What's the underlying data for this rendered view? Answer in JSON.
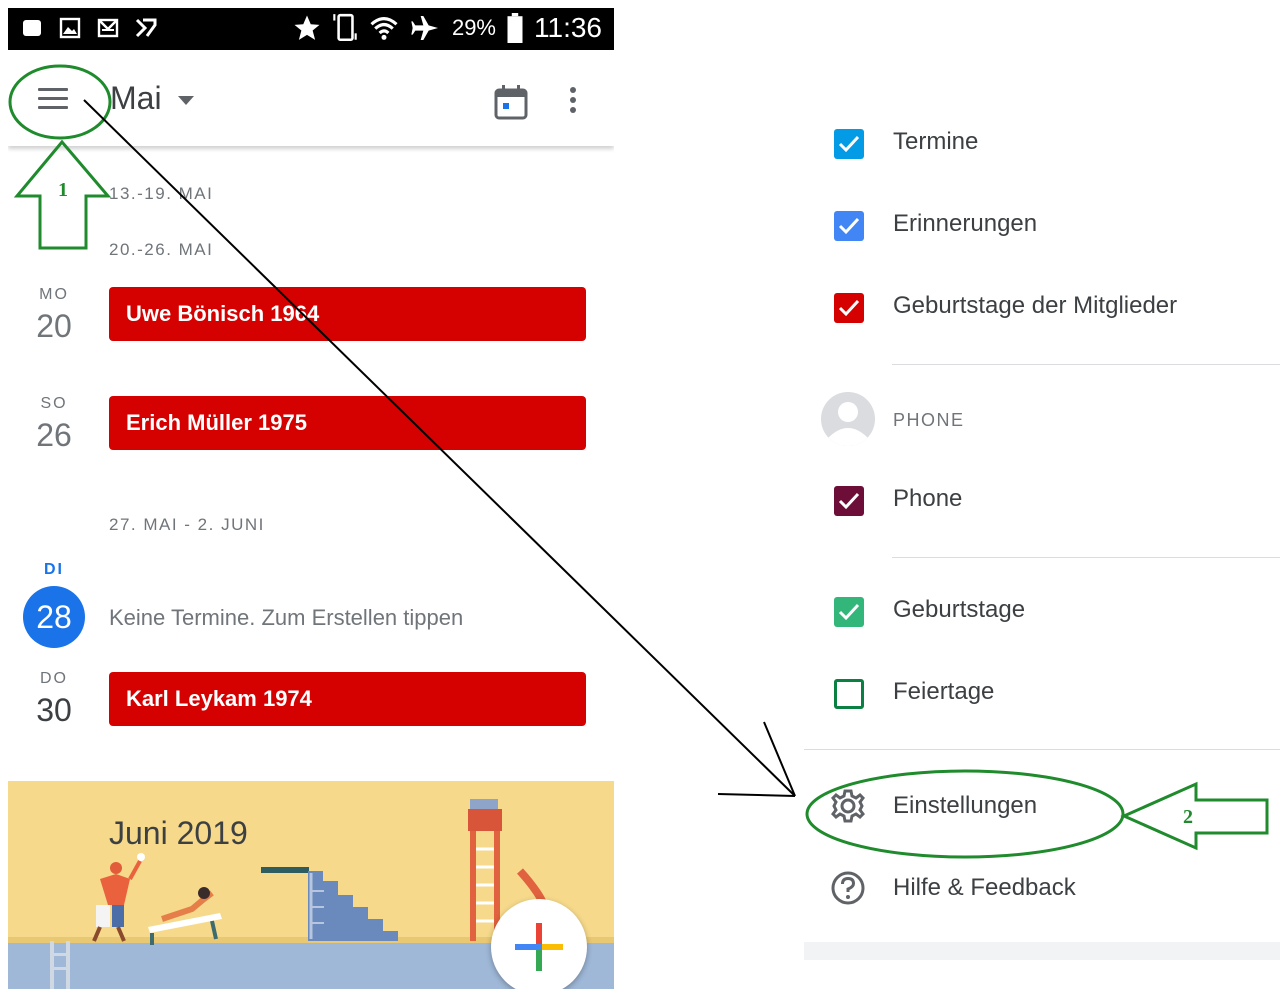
{
  "status_bar": {
    "battery_percent": "29%",
    "time": "11:36",
    "icons": [
      "notification-icon",
      "image-icon",
      "mail-icon",
      "check-icon",
      "star-icon",
      "vibrate-icon",
      "wifi-icon",
      "airplane-icon",
      "battery-icon"
    ]
  },
  "app_bar": {
    "month": "Mai",
    "icons": [
      "menu-icon",
      "caret-down-icon",
      "calendar-today-icon",
      "more-vert-icon"
    ]
  },
  "schedule": {
    "week1_label": "13.-19. MAI",
    "week2_label": "20.-26. MAI",
    "days": [
      {
        "name": "MO",
        "num": "20",
        "event": "Uwe Bönisch 1964"
      },
      {
        "name": "SO",
        "num": "26",
        "event": "Erich Müller 1975"
      }
    ],
    "week3_label": "27. MAI - 2. JUNI",
    "today": {
      "name": "DI",
      "num": "28",
      "empty_text": "Keine Termine. Zum Erstellen tippen"
    },
    "day4": {
      "name": "DO",
      "num": "30",
      "event": "Karl Leykam 1974"
    },
    "event_color": "#d50000",
    "today_color": "#1a73e8"
  },
  "banner": {
    "title": "Juni 2019",
    "bg_color": "#f6d98a"
  },
  "fab": {
    "icon": "plus-icon"
  },
  "drawer": {
    "calendars": [
      {
        "label": "Termine",
        "color": "#039be5",
        "checked": true
      },
      {
        "label": "Erinnerungen",
        "color": "#4285f4",
        "checked": true
      },
      {
        "label": "Geburtstage der Mitglieder",
        "color": "#d50000",
        "checked": true
      }
    ],
    "account_label": "PHONE",
    "phone_calendar": {
      "label": "Phone",
      "color": "#6d0e38",
      "checked": true
    },
    "other_calendars": [
      {
        "label": "Geburtstage",
        "color": "#33b679",
        "checked": true
      },
      {
        "label": "Feiertage",
        "color": "#0b8043",
        "checked": false
      }
    ],
    "settings_label": "Einstellungen",
    "help_label": "Hilfe & Feedback"
  },
  "annotations": {
    "arrow1_label": "1",
    "arrow2_label": "2",
    "annotation_color": "#1f8b2c"
  }
}
